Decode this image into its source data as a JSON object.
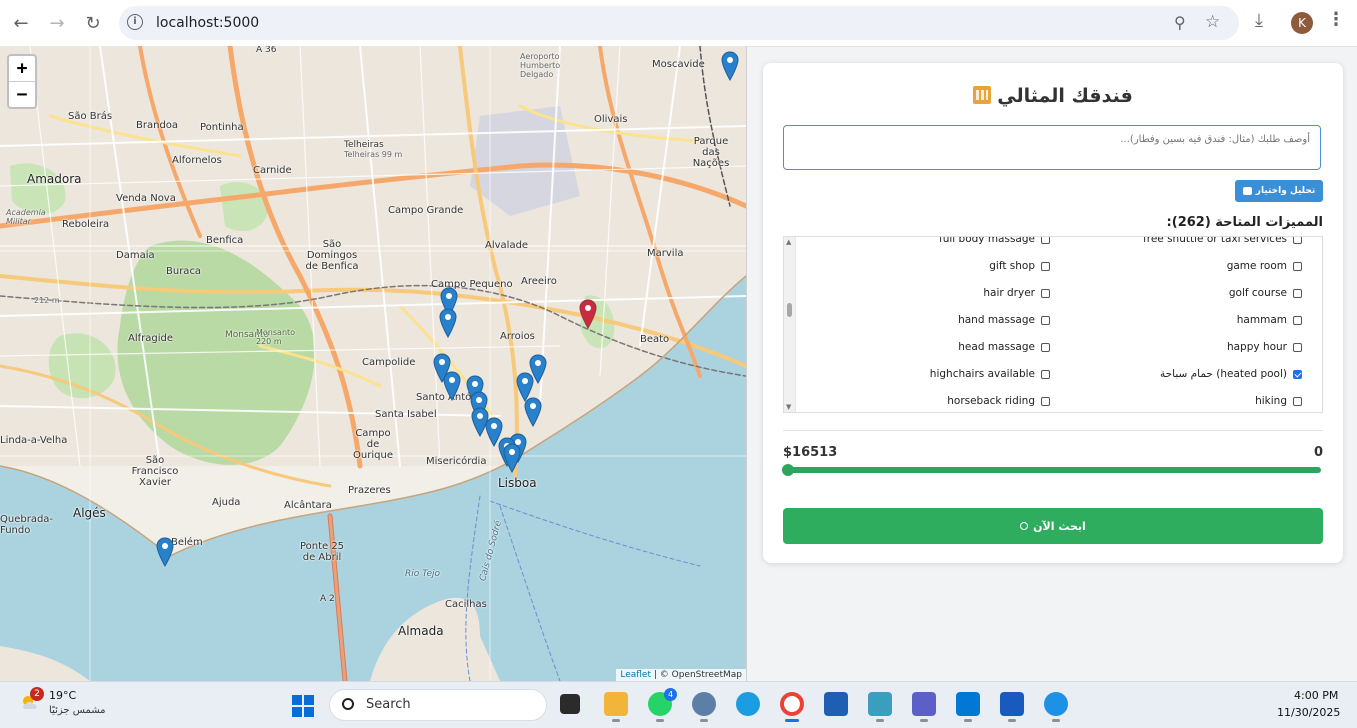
{
  "browser": {
    "url": "localhost:5000"
  },
  "map": {
    "zoom_in": "+",
    "zoom_out": "−",
    "labels": [
      "Moscavide",
      "Aeroporto Humberto Delgado",
      "Olivais",
      "Parque das Nações",
      "São Brás",
      "Brandoa",
      "Pontinha",
      "Alfornelos",
      "Amadora",
      "Carnide",
      "Venda Nova",
      "Reboleira",
      "Telheiras",
      "Campo Grande",
      "Benfica",
      "Damaia",
      "Buraca",
      "São Domingos de Benfica",
      "Alvalade",
      "Marvila",
      "Campo Pequeno",
      "Areeiro",
      "Alfragide",
      "Monsanto",
      "Arroios",
      "Beato",
      "Campolide",
      "Linda-a-Velha",
      "Santo António",
      "Santa Isabel",
      "Campo de Ourique",
      "Misericórdia",
      "São Francisco Xavier",
      "Ajuda",
      "Prazeres",
      "Alcântara",
      "Lisboa",
      "Algés",
      "Belém",
      "Ponte 25 de Abril",
      "Quebrada-Fundo",
      "Cacilhas",
      "Almada",
      "Rio Tejo",
      "Cais do Sodré",
      "A 36",
      "A 2",
      "Academia Militar",
      "Monsanto 220 m",
      "212 m",
      "Telheiras 99 m"
    ],
    "attribution_leaflet": "Leaflet",
    "attribution_rest": " | © OpenStreetMap"
  },
  "panel": {
    "title": "فندقك المثالي",
    "request_placeholder": "أوصف طلبك (مثال: فندق فيه بسين وفطار)...",
    "analyze_label": "تحليل واختيار",
    "features_title": "المميزات المتاحة (262):",
    "features": [
      {
        "label": "free shuttle or taxi services",
        "checked": false,
        "col": "right",
        "row": 0
      },
      {
        "label": "full body massage",
        "checked": false,
        "col": "left",
        "row": 0
      },
      {
        "label": "game room",
        "checked": false,
        "col": "right",
        "row": 1
      },
      {
        "label": "gift shop",
        "checked": false,
        "col": "left",
        "row": 1
      },
      {
        "label": "golf course",
        "checked": false,
        "col": "right",
        "row": 2
      },
      {
        "label": "hair dryer",
        "checked": false,
        "col": "left",
        "row": 2
      },
      {
        "label": "hammam",
        "checked": false,
        "col": "right",
        "row": 3
      },
      {
        "label": "hand massage",
        "checked": false,
        "col": "left",
        "row": 3
      },
      {
        "label": "happy hour",
        "checked": false,
        "col": "right",
        "row": 4
      },
      {
        "label": "head massage",
        "checked": false,
        "col": "left",
        "row": 4
      },
      {
        "label": "حمام سباحة (heated pool)",
        "checked": true,
        "col": "right",
        "row": 5
      },
      {
        "label": "highchairs available",
        "checked": false,
        "col": "left",
        "row": 5
      },
      {
        "label": "hiking",
        "checked": false,
        "col": "right",
        "row": 6
      },
      {
        "label": "horseback riding",
        "checked": false,
        "col": "left",
        "row": 6
      }
    ],
    "price_max": "$16513",
    "price_min": "0",
    "price_slider_fraction": 0.0,
    "search_label": "ابحث الآن"
  },
  "taskbar": {
    "weather_badge": "2",
    "temperature": "19°C",
    "weather_desc": "مشمس جزئيًا",
    "search_label": "Search",
    "whatsapp_badge": "4",
    "time": "4:00 PM",
    "date": "11/30/2025"
  },
  "colors": {
    "accent_green": "#2ead5e",
    "accent_blue": "#3b8fd6",
    "pin_blue": "#2a81cb",
    "pin_red": "#cb2b3e"
  }
}
